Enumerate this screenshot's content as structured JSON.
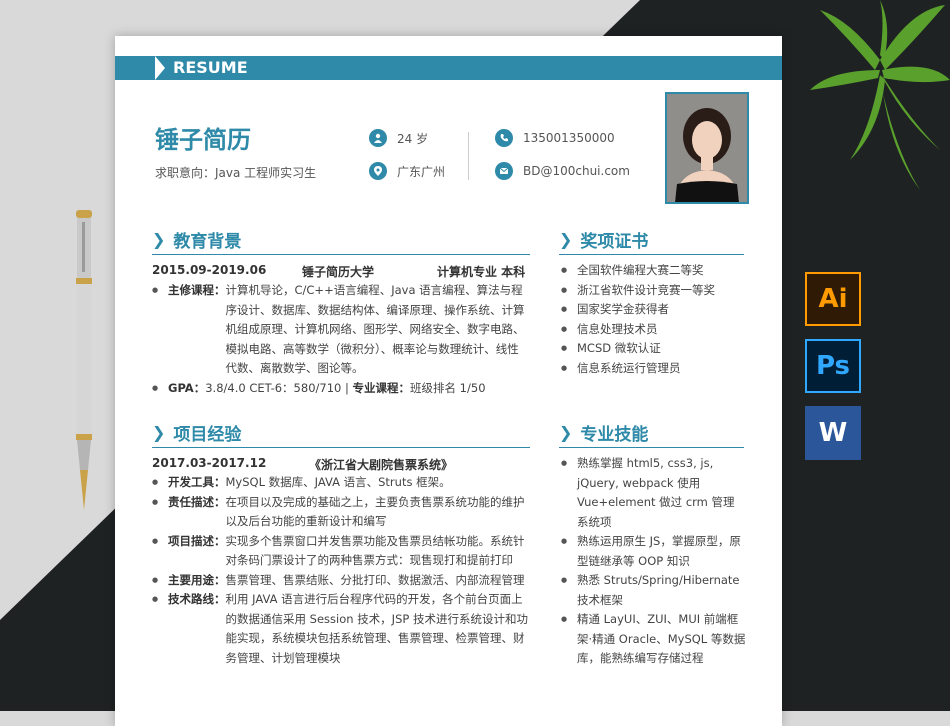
{
  "banner": {
    "label": "RESUME"
  },
  "profile": {
    "name": "锤子简历",
    "intention": "求职意向：Java 工程师实习生",
    "age": "24 岁",
    "location": "广东广州",
    "phone": "135001350000",
    "email": "BD@100chui.com"
  },
  "education": {
    "title": "教育背景",
    "period": "2015.09-2019.06",
    "school": "锤子简历大学",
    "major": "计算机专业  本科",
    "courses_label": "主修课程：",
    "courses": "计算机导论，C/C++语言编程、Java 语言编程、算法与程序设计、数据库、数据结构体、编译原理、操作系统、计算机组成原理、计算机网络、图形学、网络安全、数字电路、模拟电路、高等数学（微积分）、概率论与数理统计、线性代数、离散数学、图论等。",
    "gpa_label": "GPA：",
    "gpa": "3.8/4.0 CET-6：580/710 | ",
    "course_label": "专业课程：",
    "course_rank": "班级排名 1/50"
  },
  "awards": {
    "title": "奖项证书",
    "items": [
      "全国软件编程大赛二等奖",
      "浙江省软件设计竞赛一等奖",
      "国家奖学金获得者",
      "信息处理技术员",
      "MCSD 微软认证",
      "信息系统运行管理员"
    ]
  },
  "project": {
    "title": "项目经验",
    "period": "2017.03-2017.12",
    "name": "《浙江省大剧院售票系统》",
    "rows": [
      {
        "k": "开发工具：",
        "v": "MySQL 数据库、JAVA 语言、Struts 框架。"
      },
      {
        "k": "责任描述：",
        "v": "在项目以及完成的基础之上，主要负责售票系统功能的维护以及后台功能的重新设计和编写"
      },
      {
        "k": "项目描述：",
        "v": "实现多个售票窗口并发售票功能及售票员结帐功能。系统针对条码门票设计了的两种售票方式：现售现打和提前打印"
      },
      {
        "k": "主要用途：",
        "v": "售票管理、售票结账、分批打印、数据激活、内部流程管理"
      },
      {
        "k": "技术路线：",
        "v": "利用 JAVA 语言进行后台程序代码的开发，各个前台页面上的数据通信采用 Session 技术，JSP 技术进行系统设计和功能实现，系统模块包括系统管理、售票管理、检票管理、财务管理、计划管理模块"
      }
    ]
  },
  "skills": {
    "title": "专业技能",
    "items": [
      "熟练掌握 html5, css3, js, jQuery, webpack 使用 Vue+element 做过 crm 管理系统项",
      "熟练运用原生 JS，掌握原型，原型链继承等 OOP 知识",
      "熟悉 Struts/Spring/Hibernate 技术框架",
      "精通 LayUI、ZUI、MUI 前端框架·精通 Oracle、MySQL 等数据库，能熟练编写存储过程"
    ]
  },
  "side_icons": [
    {
      "label": "Ai",
      "color": "#ff9a00",
      "bg": "#2e1a05"
    },
    {
      "label": "Ps",
      "color": "#31a8ff",
      "bg": "#001e36"
    },
    {
      "label": "W",
      "color": "#ffffff",
      "bg": "#2b579a"
    }
  ],
  "colors": {
    "accent": "#2e8aa8",
    "dark_bg": "#1f2223"
  }
}
